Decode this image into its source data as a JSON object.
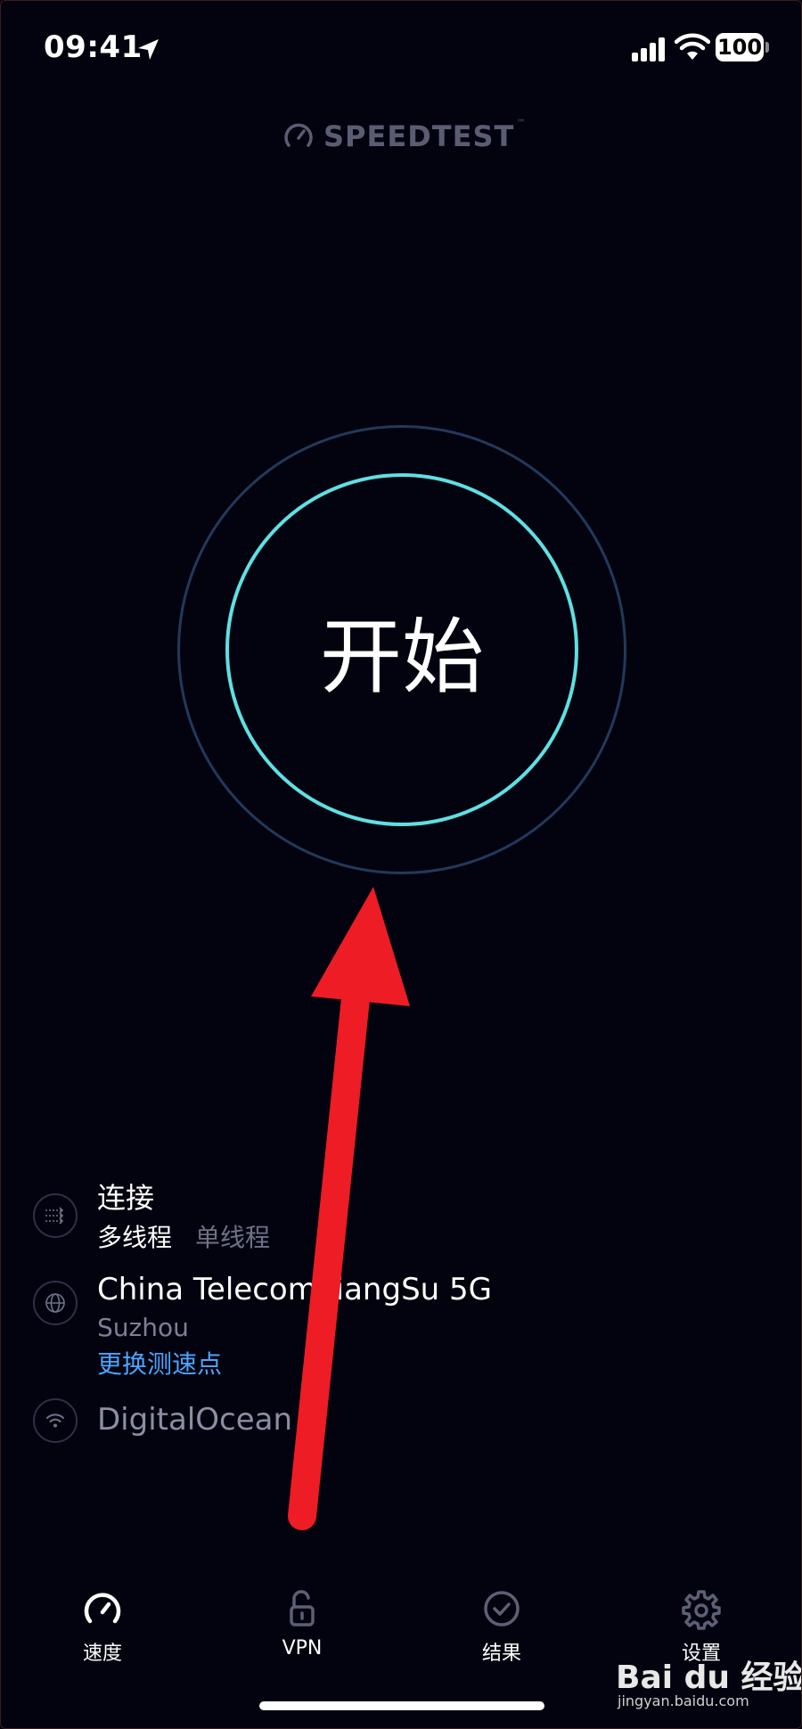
{
  "status_bar": {
    "time": "09:41",
    "battery": "100",
    "icons": [
      "location-arrow-icon",
      "signal-bars-icon",
      "wifi-icon"
    ]
  },
  "header": {
    "logo_text": "SPEEDTEST",
    "logo_mark": "™"
  },
  "go_button": {
    "label": "开始"
  },
  "connection": {
    "title": "连接",
    "options": [
      "多线程",
      "单线程"
    ],
    "selected": "多线程",
    "icon": "multi-connection-icon"
  },
  "server": {
    "name": "China Telecom JiangSu 5G",
    "city": "Suzhou",
    "change_label": "更换测速点",
    "icon": "globe-icon"
  },
  "network": {
    "name": "DigitalOcean",
    "icon": "wifi-icon"
  },
  "tabs": [
    {
      "label": "速度",
      "icon": "speedometer-icon",
      "active": true
    },
    {
      "label": "VPN",
      "icon": "unlock-icon",
      "active": false
    },
    {
      "label": "结果",
      "icon": "check-circle-icon",
      "active": false
    },
    {
      "label": "设置",
      "icon": "gear-icon",
      "active": false
    }
  ],
  "watermark": {
    "text": "Bai du 经验",
    "url": "jingyan.baidu.com"
  },
  "colors": {
    "background": "#03030f",
    "ring_inner": "#5fe0e2",
    "ring_outer": "#22395a",
    "link": "#4da3ff",
    "annotation_arrow": "#ee1c25"
  }
}
